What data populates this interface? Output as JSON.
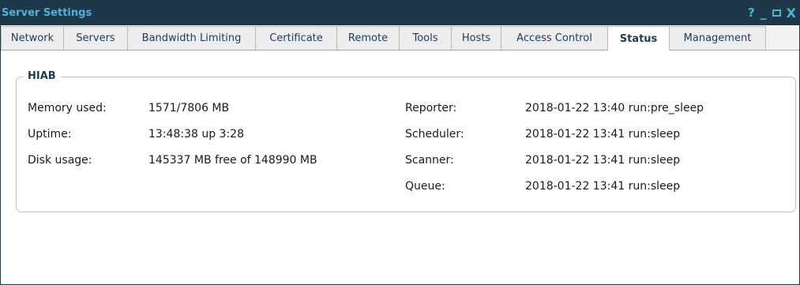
{
  "window": {
    "title": "Server Settings",
    "controls": {
      "help": "?",
      "minimize": "_",
      "close": "X"
    }
  },
  "tabs": [
    {
      "label": "Network"
    },
    {
      "label": "Servers"
    },
    {
      "label": "Bandwidth Limiting"
    },
    {
      "label": "Certificate"
    },
    {
      "label": "Remote"
    },
    {
      "label": "Tools"
    },
    {
      "label": "Hosts"
    },
    {
      "label": "Access Control"
    },
    {
      "label": "Status",
      "active": true
    },
    {
      "label": "Management"
    }
  ],
  "status": {
    "group_title": "HIAB",
    "left": [
      {
        "label": "Memory used:",
        "value": "1571/7806 MB"
      },
      {
        "label": "Uptime:",
        "value": "13:48:38 up 3:28"
      },
      {
        "label": "Disk usage:",
        "value": "145337 MB free of 148990 MB"
      }
    ],
    "right": [
      {
        "label": "Reporter:",
        "value": "2018-01-22 13:40 run:pre_sleep"
      },
      {
        "label": "Scheduler:",
        "value": "2018-01-22 13:41 run:sleep"
      },
      {
        "label": "Scanner:",
        "value": "2018-01-22 13:41 run:sleep"
      },
      {
        "label": "Queue:",
        "value": "2018-01-22 13:41 run:sleep"
      }
    ]
  }
}
